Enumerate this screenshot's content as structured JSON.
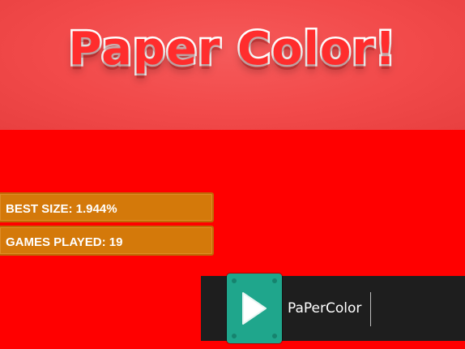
{
  "game": {
    "title": "Paper Color!",
    "colors": {
      "background": "#ff0000",
      "banner": "#f24a4a",
      "stat_box": "#d4790a",
      "play_tile": "#1fa68c",
      "video_bar": "#1e1e1e"
    }
  },
  "stats": {
    "best_size": "BEST SIZE: 1.944%",
    "games_played": "GAMES PLAYED: 19"
  },
  "video_bar": {
    "title": "PaPerColor",
    "icon": "play-icon"
  }
}
